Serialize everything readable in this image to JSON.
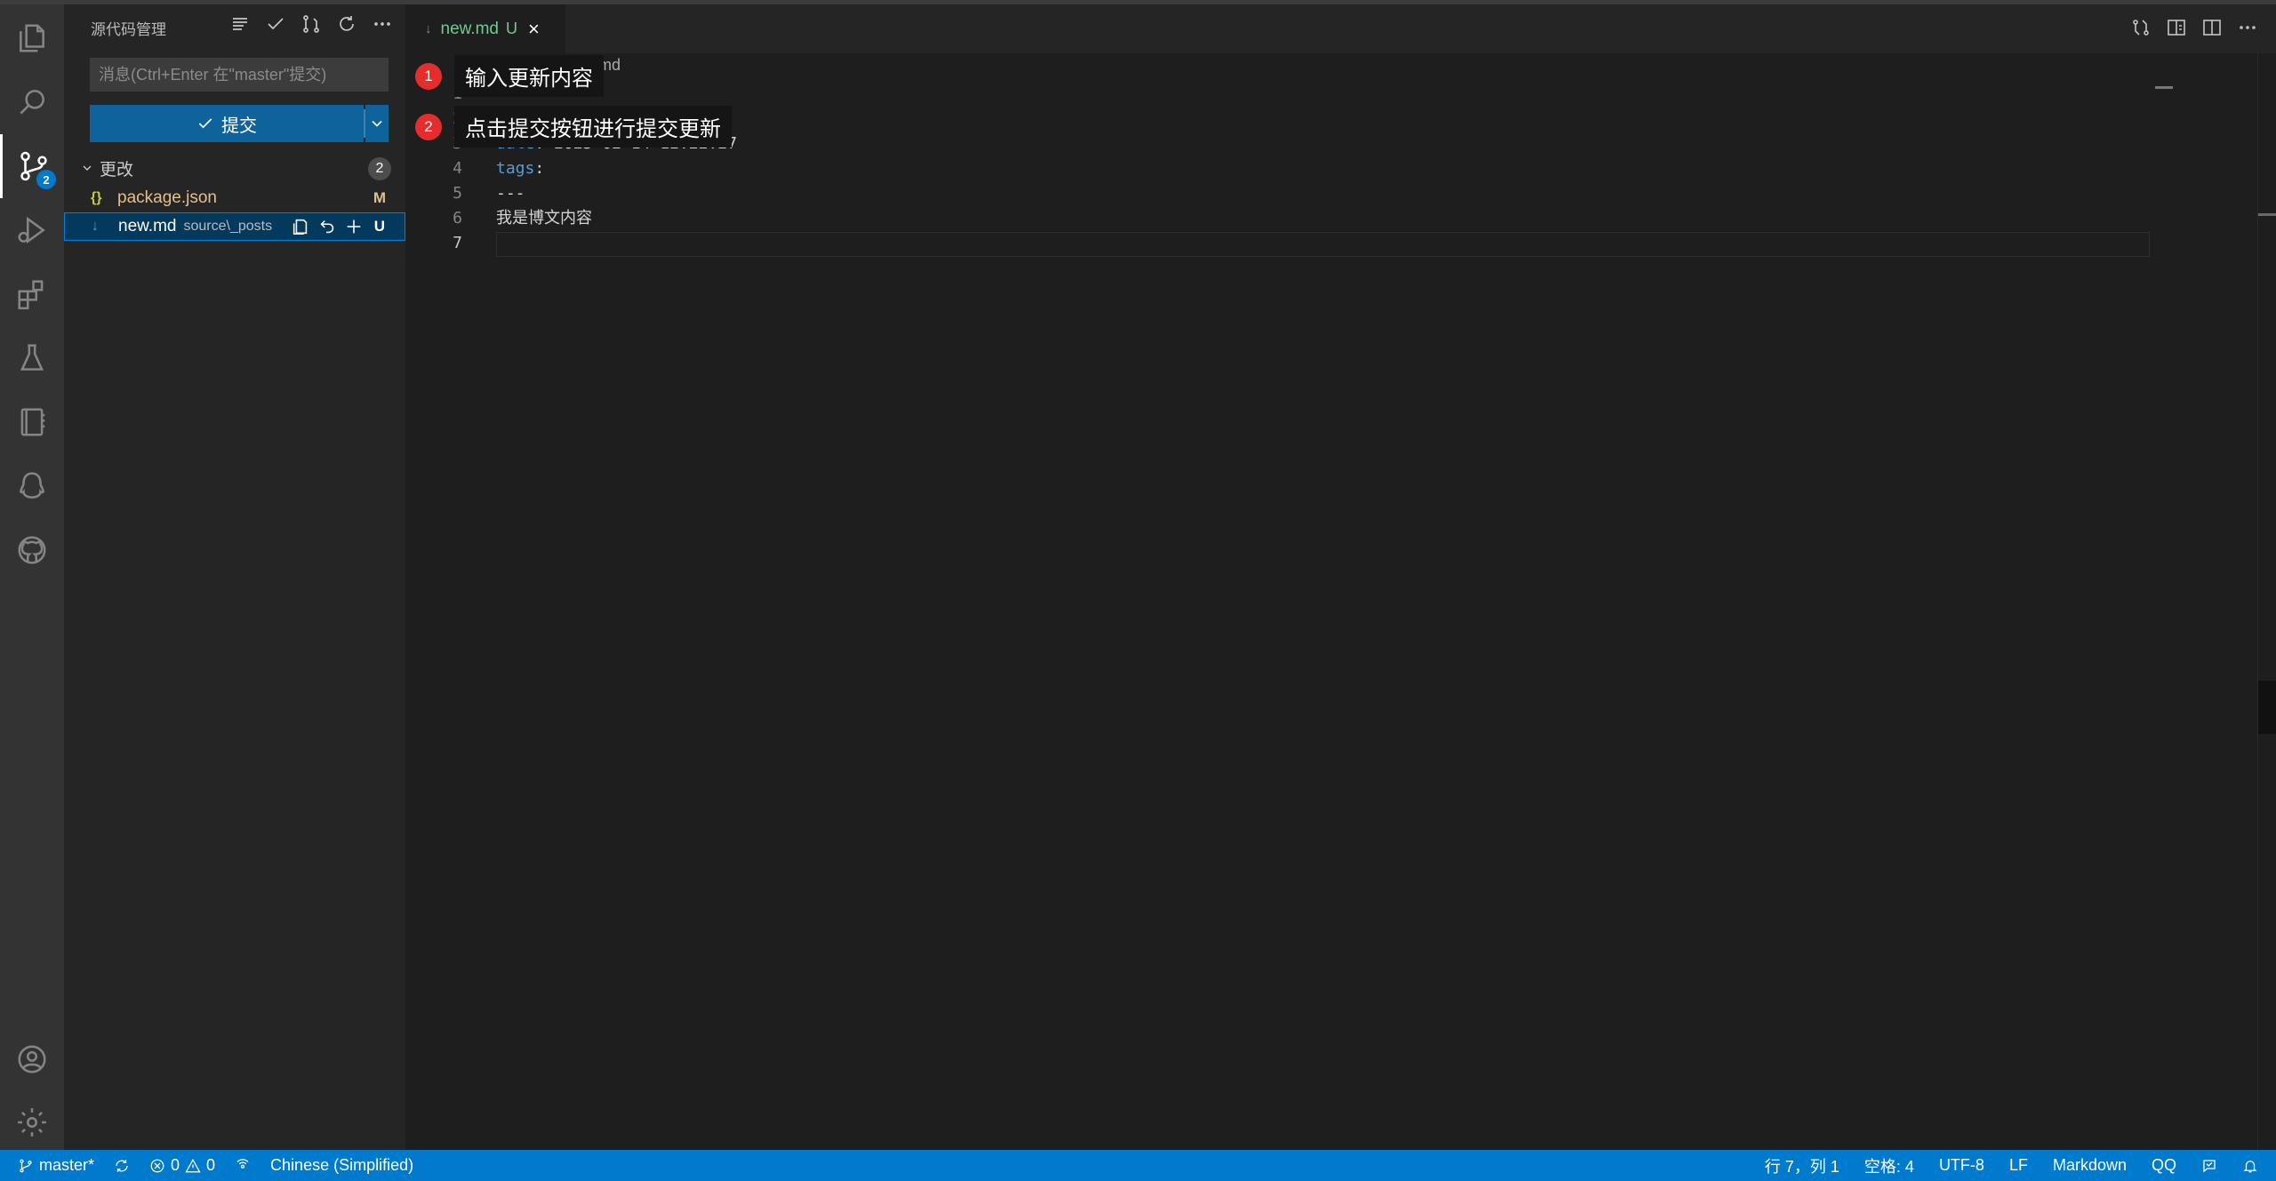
{
  "sidebar": {
    "title": "源代码管理",
    "message_placeholder": "消息(Ctrl+Enter 在\"master\"提交)",
    "commit_label": "提交",
    "changes_label": "更改",
    "changes_count": "2",
    "files": [
      {
        "icon": "{}",
        "name": "package.json",
        "dir": "",
        "status": "M"
      },
      {
        "icon": "↓",
        "name": "new.md",
        "dir": "source\\_posts",
        "status": "U"
      }
    ]
  },
  "activity": {
    "scm_badge": "2",
    "items": [
      "explorer-icon",
      "search-icon",
      "source-control-icon",
      "run-debug-icon",
      "extensions-icon",
      "testing-icon",
      "notebook-icon",
      "qq-icon",
      "github-icon",
      "account-icon",
      "settings-gear-icon"
    ]
  },
  "tab": {
    "name": "new.md",
    "status": "U",
    "close": "×"
  },
  "breadcrumb": "new.md",
  "editor": {
    "lines": [
      {
        "n": "1",
        "key": "",
        "text": "---"
      },
      {
        "n": "2",
        "key": "",
        "text": ""
      },
      {
        "n": "3",
        "key": "date",
        "text": ": 2023-02-14 12:22:27"
      },
      {
        "n": "4",
        "key": "tags",
        "text": ":"
      },
      {
        "n": "5",
        "key": "",
        "text": "---"
      },
      {
        "n": "6",
        "key": "",
        "text": "我是博文内容"
      },
      {
        "n": "7",
        "key": "",
        "text": ""
      }
    ]
  },
  "annotations": [
    {
      "num": "1",
      "text": "输入更新内容"
    },
    {
      "num": "2",
      "text": "点击提交按钮进行提交更新"
    }
  ],
  "status": {
    "branch": "master*",
    "errors": "0",
    "warnings": "0",
    "language_pack": "Chinese (Simplified)",
    "position": "行 7，列 1",
    "spaces": "空格: 4",
    "encoding": "UTF-8",
    "eol": "LF",
    "mode": "Markdown",
    "qq": "QQ"
  },
  "colors": {
    "accent": "#007acc",
    "commit_button": "#0e639c",
    "annotation": "#e52d2d",
    "modified": "#e2c08d",
    "untracked": "#73c991"
  }
}
